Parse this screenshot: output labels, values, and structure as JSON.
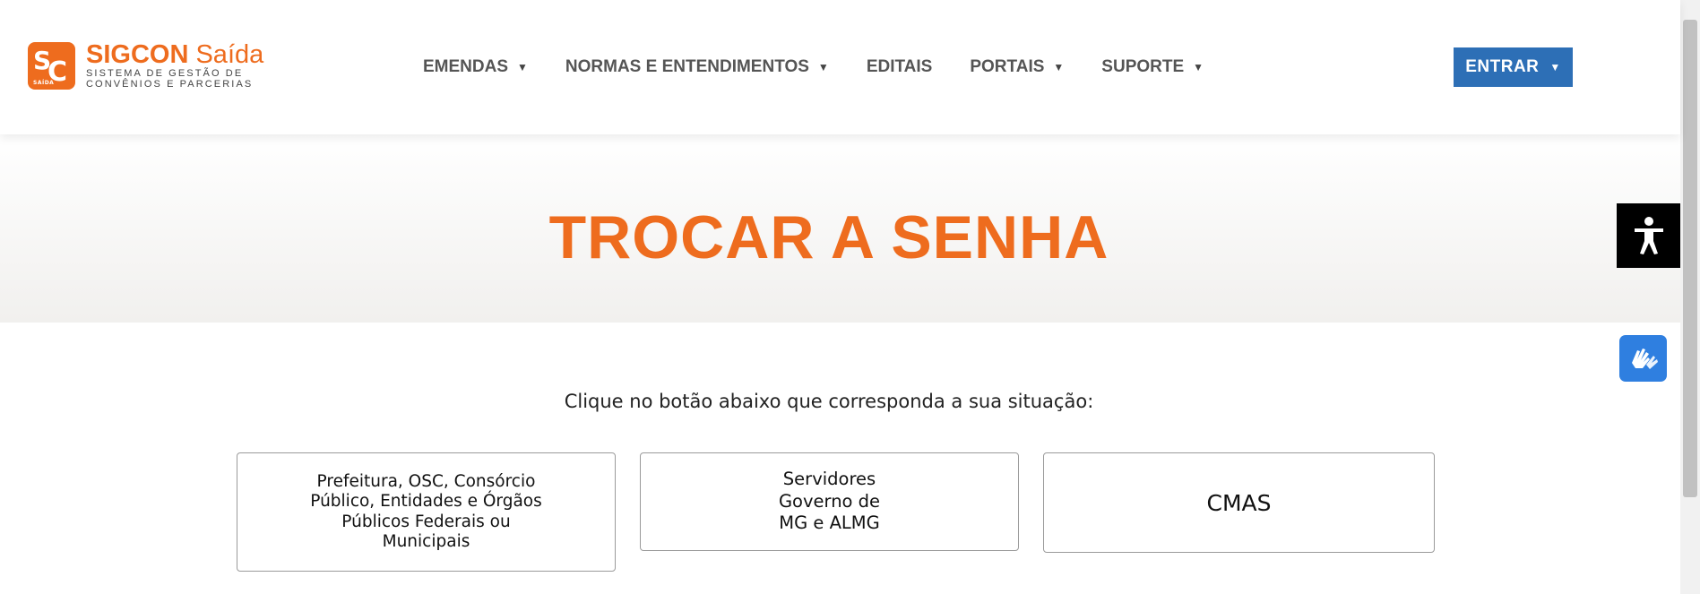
{
  "brand": {
    "mark_letters": [
      "S",
      "C"
    ],
    "mark_tag": "SAÍDA",
    "title_bold": "SIGCON",
    "title_light": "Saída",
    "subtitle_line1": "Sistema de Gestão de",
    "subtitle_line2": "Convênios e Parcerias",
    "color": "#ee6c1e"
  },
  "nav": {
    "items": [
      {
        "label": "EMENDAS",
        "dropdown": true
      },
      {
        "label": "NORMAS E ENTENDIMENTOS",
        "dropdown": true
      },
      {
        "label": "EDITAIS",
        "dropdown": false
      },
      {
        "label": "PORTAIS",
        "dropdown": true
      },
      {
        "label": "SUPORTE",
        "dropdown": true
      }
    ],
    "enter_label": "ENTRAR",
    "enter_color": "#2d6fb6"
  },
  "hero": {
    "title": "TROCAR A SENHA"
  },
  "content": {
    "instruction": "Clique no botão abaixo que corresponda a sua situação:",
    "choices": [
      "Prefeitura, OSC, Consórcio\nPúblico, Entidades e Órgãos\nPúblicos Federais ou\nMunicipais",
      "Servidores\nGoverno de\nMG e ALMG",
      "CMAS"
    ]
  },
  "widgets": {
    "accessibility_icon": "accessibility-icon",
    "libras_icon": "sign-language-icon"
  }
}
